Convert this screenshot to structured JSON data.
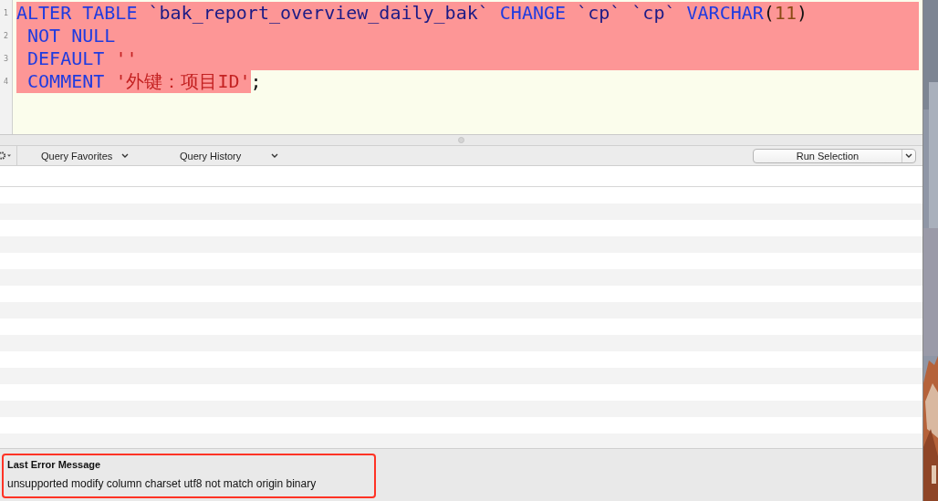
{
  "editor": {
    "lines": [
      {
        "number": "1",
        "selected": true,
        "tokens": [
          {
            "text": "ALTER TABLE ",
            "kind": "keyword"
          },
          {
            "text": "`bak_report_overview_daily_bak`",
            "kind": "identifier"
          },
          {
            "text": " CHANGE ",
            "kind": "keyword"
          },
          {
            "text": "`cp` `cp`",
            "kind": "identifier"
          },
          {
            "text": " VARCHAR",
            "kind": "keyword"
          },
          {
            "text": "(",
            "kind": "punct"
          },
          {
            "text": "11",
            "kind": "number"
          },
          {
            "text": ")",
            "kind": "punct"
          }
        ]
      },
      {
        "number": "2",
        "selected": true,
        "tokens": [
          {
            "text": " NOT NULL",
            "kind": "keyword"
          }
        ]
      },
      {
        "number": "3",
        "selected": true,
        "tokens": [
          {
            "text": " DEFAULT ",
            "kind": "keyword"
          },
          {
            "text": "''",
            "kind": "string"
          }
        ]
      },
      {
        "number": "4",
        "selected": false,
        "tokens": [
          {
            "text": " COMMENT ",
            "kind": "keyword",
            "selected": true
          },
          {
            "text": "'外键：项目ID'",
            "kind": "string",
            "selected": true
          },
          {
            "text": ";",
            "kind": "punct",
            "selected": false
          }
        ]
      }
    ]
  },
  "toolbar": {
    "query_favorites": "Query Favorites",
    "query_history": "Query History",
    "run_button": "Run Selection"
  },
  "error_panel": {
    "title": "Last Error Message",
    "message": "unsupported modify column charset utf8 not match origin binary",
    "annotated": true
  }
}
